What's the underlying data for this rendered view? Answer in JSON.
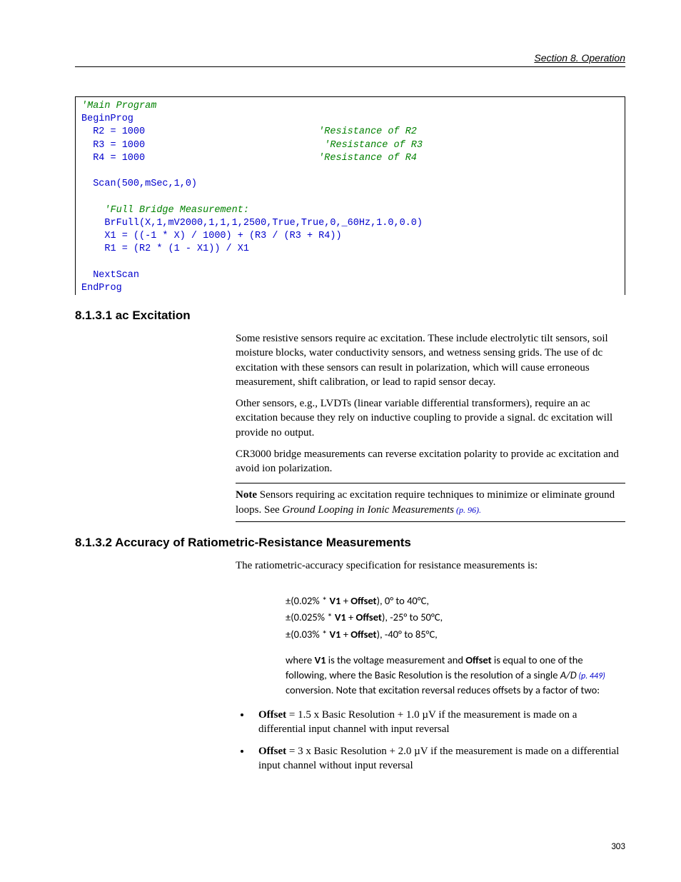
{
  "header": {
    "section": "Section 8.  Operation"
  },
  "code": {
    "c1": "'Main Program",
    "l1": "BeginProg",
    "l2": "  R2 = 1000",
    "c2": "'Resistance of R2",
    "l3": "  R3 = 1000",
    "c3": "'Resistance of R3",
    "l4": "  R4 = 1000",
    "c4": "'Resistance of R4",
    "l5": "  Scan(500,mSec,1,0)",
    "c5": "    'Full Bridge Measurement:",
    "l6": "    BrFull(X,1,mV2000,1,1,1,2500,True,True,0,_60Hz,1.0,0.0)",
    "l7": "    X1 = ((-1 * X) / 1000) + (R3 / (R3 + R4))",
    "l8": "    R1 = (R2 * (1 - X1)) / X1",
    "l9": "  NextScan",
    "l10": "EndProg"
  },
  "s1": {
    "heading": "8.1.3.1 ac Excitation",
    "p1": "Some resistive sensors require ac excitation. These include electrolytic tilt sensors, soil moisture blocks, water conductivity sensors, and wetness sensing grids. The use of dc excitation with these sensors can result in polarization, which will cause erroneous measurement, shift calibration, or lead to rapid sensor decay.",
    "p2": "Other sensors, e.g., LVDTs (linear variable differential transformers), require an ac excitation because they rely on inductive coupling to provide a signal. dc excitation will provide no output.",
    "p3": "CR3000 bridge measurements can reverse excitation polarity to provide ac excitation and avoid ion polarization.",
    "note_label": "Note",
    "note_text": "  Sensors requiring ac excitation require techniques to minimize or eliminate ground loops. See ",
    "note_em": "Ground Looping in Ionic Measurements",
    "note_link": " (p. 96)."
  },
  "s2": {
    "heading": "8.1.3.2 Accuracy of Ratiometric-Resistance Measurements",
    "intro": "The ratiometric-accuracy specification for resistance measurements is:",
    "spec1a": "±(0.02% * ",
    "spec1b": "V1",
    "spec1c": " + ",
    "spec1d": "Offset",
    "spec1e": "), 0° to 40°C,",
    "spec2a": "±(0.025% * ",
    "spec2e": "), -25° to 50°C,",
    "spec3a": "±(0.03% * ",
    "spec3e": "), -40° to 85°C,",
    "where1": "where ",
    "where2": " is the voltage measurement and ",
    "where3": " is equal to one of the following, where the Basic Resolution is the resolution of a single ",
    "where_em": "A/D",
    "where_link": " (p. 449)",
    "where4": " conversion.  Note that excitation reversal reduces offsets by a factor of two:",
    "b1_label": "Offset",
    "b1_text": " = 1.5 x Basic Resolution + 1.0 µV if the measurement is made on a differential input channel with input reversal",
    "b2_text": " = 3 x Basic Resolution + 2.0 µV if the measurement is made on a differential input channel without input reversal"
  },
  "page": "303"
}
